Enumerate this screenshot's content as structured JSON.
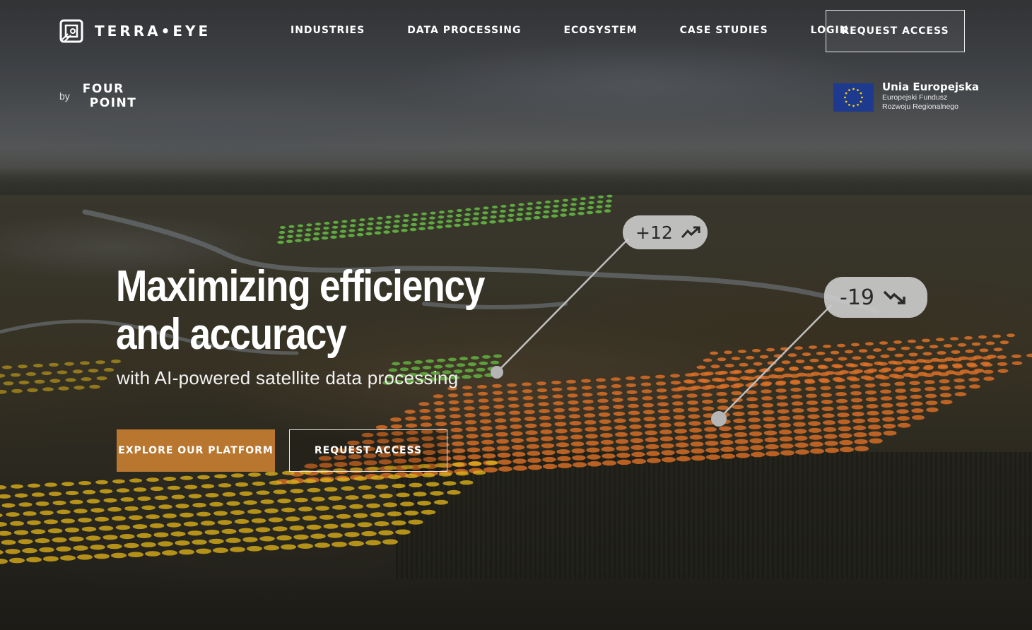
{
  "brand": {
    "name": "TERRA•EYE",
    "logo_icon": "terraeye-logo-icon"
  },
  "nav": {
    "items": [
      "INDUSTRIES",
      "DATA PROCESSING",
      "ECOSYSTEM",
      "CASE STUDIES",
      "LOGIN"
    ],
    "cta_label": "REQUEST ACCESS"
  },
  "byline": {
    "by": "by",
    "partner_line1": "FOUR",
    "partner_line2": "POINT"
  },
  "eu": {
    "title": "Unia Europejska",
    "subtitle_line1": "Europejski Fundusz",
    "subtitle_line2": "Rozwoju Regionalnego",
    "flag_color": "#1d3a8f",
    "star_color": "#f5d200"
  },
  "hero": {
    "title_line1": "Maximizing efficiency",
    "title_line2": "and accuracy",
    "subtitle": "with AI-powered satellite data processing",
    "primary_button": "EXPLORE OUR PLATFORM",
    "secondary_button": "REQUEST ACCESS"
  },
  "callouts": [
    {
      "value": "+12",
      "trend": "trend-up-icon"
    },
    {
      "value": "-19",
      "trend": "trend-down-icon"
    }
  ],
  "colors": {
    "accent": "#b8762f",
    "field_green": "#6fd34a",
    "field_orange": "#f07a2a",
    "field_yellow": "#f2c21b"
  }
}
